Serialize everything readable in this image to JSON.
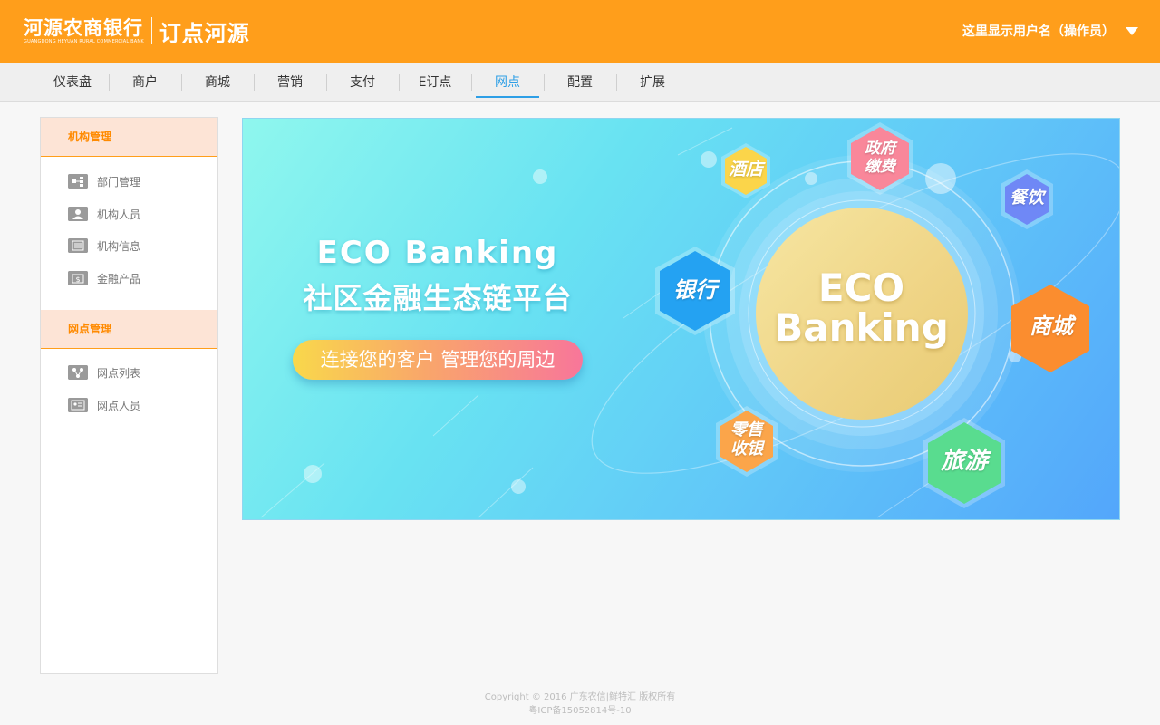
{
  "header": {
    "bank_name": "河源农商银行",
    "bank_eng": "GUANGDONG HEYUAN RURAL COMMERCIAL BANK",
    "app_name": "订点河源",
    "user_label": "这里显示用户名（操作员）",
    "brand_color": "#ff9e1b"
  },
  "nav": {
    "items": [
      {
        "label": "仪表盘"
      },
      {
        "label": "商户"
      },
      {
        "label": "商城"
      },
      {
        "label": "营销"
      },
      {
        "label": "支付"
      },
      {
        "label": "E订点"
      },
      {
        "label": "网点"
      },
      {
        "label": "配置"
      },
      {
        "label": "扩展"
      }
    ],
    "active": "网点",
    "active_color": "#2e9fe6"
  },
  "sidebar": {
    "sections": [
      {
        "title": "机构管理",
        "items": [
          {
            "label": "部门管理",
            "icon": "org-chart-icon"
          },
          {
            "label": "机构人员",
            "icon": "person-icon"
          },
          {
            "label": "机构信息",
            "icon": "info-list-icon"
          },
          {
            "label": "金融产品",
            "icon": "money-icon"
          }
        ]
      },
      {
        "title": "网点管理",
        "items": [
          {
            "label": "网点列表",
            "icon": "network-icon"
          },
          {
            "label": "网点人员",
            "icon": "id-card-icon"
          }
        ]
      }
    ]
  },
  "banner": {
    "title": "ECO Banking",
    "subtitle": "社区金融生态链平台",
    "slogan": "连接您的客户 管理您的周边",
    "center_line1": "ECO",
    "center_line2": "Banking",
    "hexes": {
      "hotel": "酒店",
      "gov_line1": "政府",
      "gov_line2": "缴费",
      "dining": "餐饮",
      "bank": "银行",
      "mall": "商城",
      "retail_line1": "零售",
      "retail_line2": "收银",
      "travel": "旅游"
    }
  },
  "footer": {
    "copyright": "Copyright © 2016 广东农信|鲜特汇 版权所有",
    "icp": "粤ICP备15052814号-10"
  }
}
